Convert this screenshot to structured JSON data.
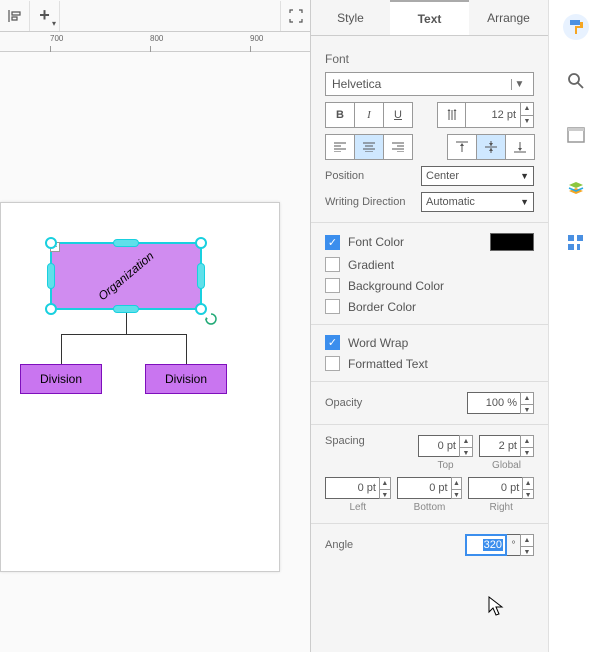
{
  "toolbar": {
    "ruler_ticks": [
      "700",
      "800",
      "900"
    ]
  },
  "diagram": {
    "org_label": "Organization",
    "division1": "Division",
    "division2": "Division",
    "collapse": "−"
  },
  "tabs": {
    "style": "Style",
    "text": "Text",
    "arrange": "Arrange",
    "active": "Text"
  },
  "font": {
    "section": "Font",
    "family": "Helvetica",
    "size": "12 pt",
    "bold": "B",
    "italic": "I",
    "underline": "U"
  },
  "position": {
    "label": "Position",
    "value": "Center"
  },
  "writing_direction": {
    "label": "Writing Direction",
    "value": "Automatic"
  },
  "font_color": {
    "label": "Font Color",
    "color": "#000000",
    "checked": true
  },
  "gradient": {
    "label": "Gradient",
    "checked": false
  },
  "background_color": {
    "label": "Background Color",
    "checked": false
  },
  "border_color": {
    "label": "Border Color",
    "checked": false
  },
  "word_wrap": {
    "label": "Word Wrap",
    "checked": true
  },
  "formatted_text": {
    "label": "Formatted Text",
    "checked": false
  },
  "opacity": {
    "label": "Opacity",
    "value": "100 %"
  },
  "spacing": {
    "label": "Spacing",
    "top": {
      "label": "Top",
      "value": "0 pt"
    },
    "global": {
      "label": "Global",
      "value": "2 pt"
    },
    "left": {
      "label": "Left",
      "value": "0 pt"
    },
    "bottom": {
      "label": "Bottom",
      "value": "0 pt"
    },
    "right": {
      "label": "Right",
      "value": "0 pt"
    }
  },
  "angle": {
    "label": "Angle",
    "value": "320",
    "suffix": "°"
  }
}
